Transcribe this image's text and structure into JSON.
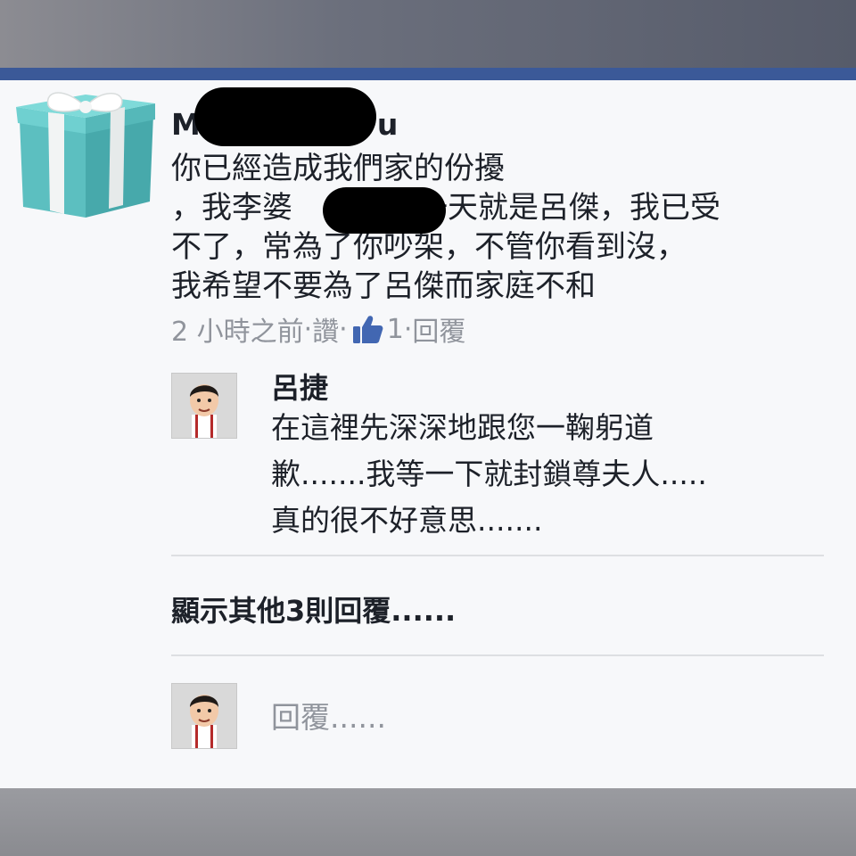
{
  "colors": {
    "nav_blue": "#3b5998",
    "text_primary": "#1d2129",
    "text_meta": "#90949c",
    "like_blue": "#4267b2"
  },
  "comment": {
    "author_name_start": "M",
    "author_name_end": "u",
    "lines": [
      "你已經造成我們家的份擾",
      "，我李婆",
      "一天就是呂傑，我已受",
      "不了，常為了你吵架，不管你看到沒，",
      "我希望不要為了呂傑而家庭不和"
    ],
    "avatar_icon": "gift-box-icon",
    "timestamp": "2 小時之前",
    "separator": " · ",
    "like_label": "讚",
    "like_icon": "thumbs-up-icon",
    "like_count": "1",
    "reply_label": "回覆"
  },
  "reply": {
    "author_name": "呂捷",
    "avatar_icon": "caricature-avatar-icon",
    "lines": [
      "在這裡先深深地跟您一鞠躬道",
      "歉.......我等一下就封鎖尊夫人.....",
      "真的很不好意思......."
    ]
  },
  "more_replies_label": "顯示其他3則回覆......",
  "reply_box": {
    "placeholder": "回覆......"
  }
}
